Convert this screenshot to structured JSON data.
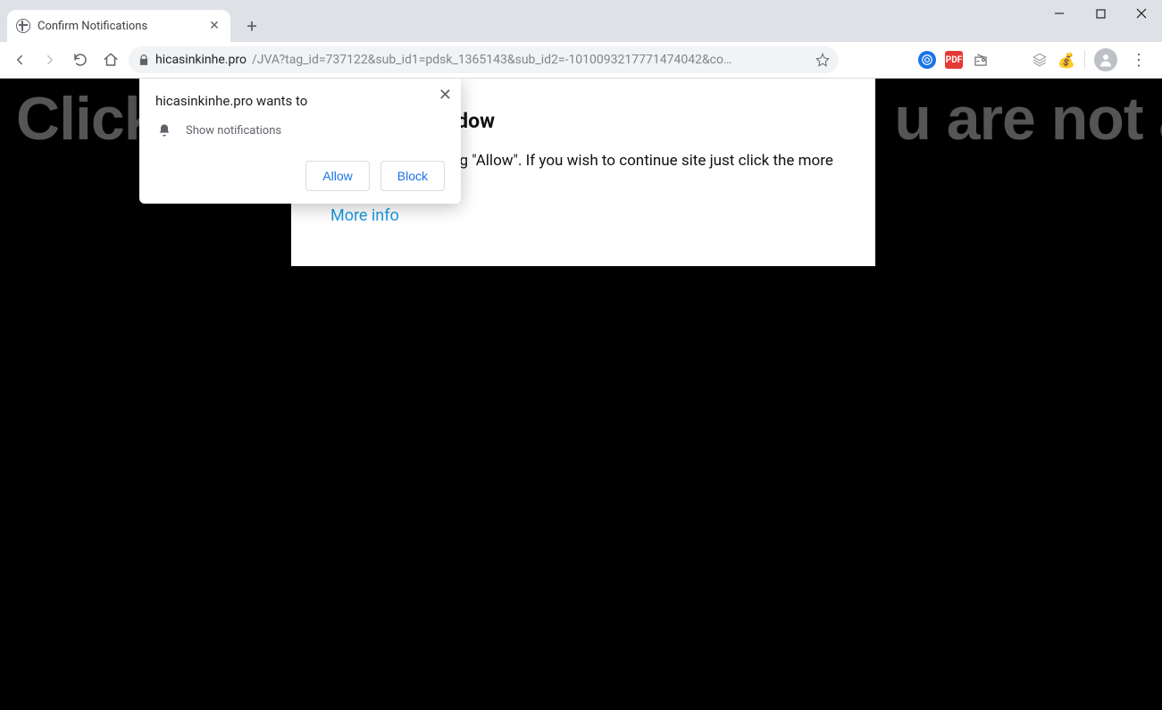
{
  "window": {
    "minimize_glyph": "—",
    "maximize_glyph": "▢",
    "close_glyph": "✕"
  },
  "tab": {
    "title": "Confirm Notifications",
    "close_glyph": "✕",
    "new_tab_glyph": "+"
  },
  "toolbar": {
    "url_host": "hicasinkinhe.pro",
    "url_rest": "/JVA?tag_id=737122&sub_id1=pdsk_1365143&sub_id2=-1010093217771474042&co…",
    "ext_pdf_label": "PDF"
  },
  "page": {
    "bg_text_left": "Click",
    "bg_text_right": "u are not a",
    "panel_heading_visible": " close this window",
    "panel_body_visible": "e closed by pressing \"Allow\". If you wish to continue site just click the more info button",
    "more_info": "More info"
  },
  "popup": {
    "title": "hicasinkinhe.pro wants to",
    "notification_label": "Show notifications",
    "allow": "Allow",
    "block": "Block",
    "close_glyph": "✕"
  }
}
